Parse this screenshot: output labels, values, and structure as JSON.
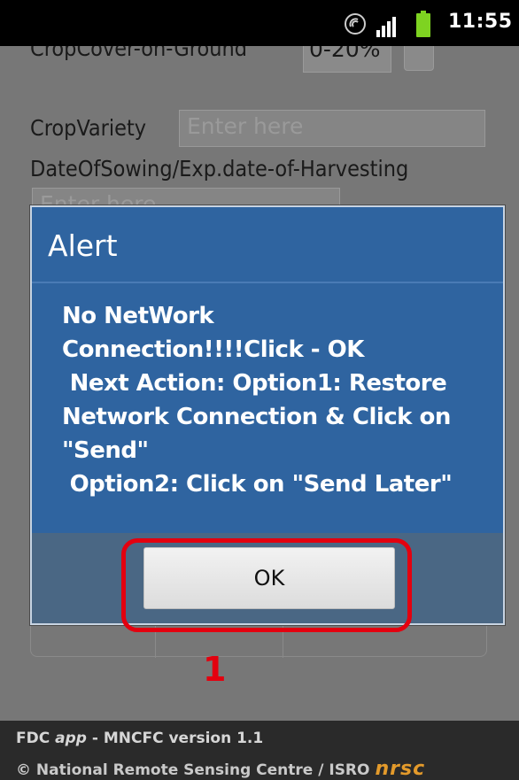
{
  "status_bar": {
    "time": "11:55",
    "icons": [
      "wifi-icon",
      "signal-icon",
      "battery-icon"
    ],
    "battery_color": "#7ed321"
  },
  "form": {
    "crop_cover_label": "CropCover-on-Ground",
    "crop_cover_value": "0-20%",
    "crop_variety_label": "CropVariety",
    "crop_variety_placeholder": "Enter here",
    "date_label": "DateOfSowing/Exp.date-of-Harvesting",
    "date_placeholder": "Enter here"
  },
  "dialog": {
    "title": "Alert",
    "message": "No NetWork\nConnection!!!!Click - OK\n Next Action: Option1: Restore\nNetwork Connection & Click on\n\"Send\"\n Option2: Click on \"Send Later\"",
    "ok_label": "OK",
    "background_color": "#2f64a0"
  },
  "annotation": {
    "step_number": "1",
    "color": "#e3000f"
  },
  "footer": {
    "line1_prefix": "FDC ",
    "line1_app": "app",
    "line1_suffix": " - MNCFC version 1.1",
    "line2": "© National Remote Sensing Centre / ISRO",
    "logo_text": "nrsc"
  }
}
